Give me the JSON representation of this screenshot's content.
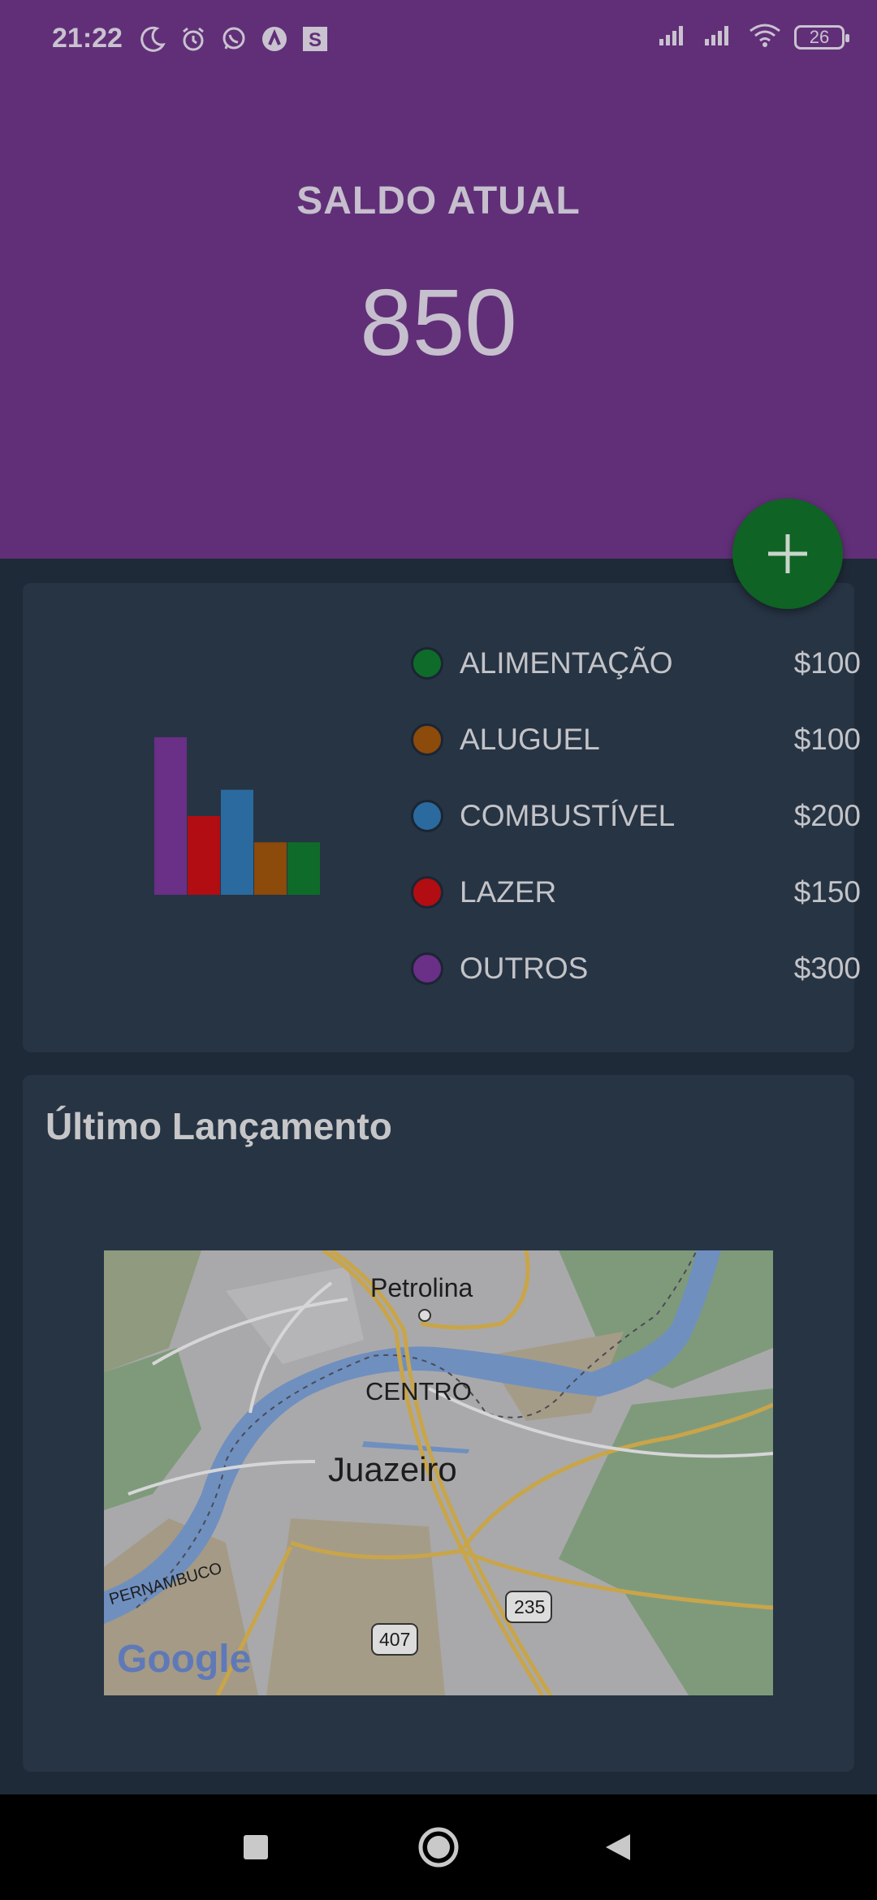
{
  "status_bar": {
    "time": "21:22",
    "battery": "26",
    "icons": [
      "moon-icon",
      "alarm-icon",
      "whatsapp-icon",
      "app-a-icon",
      "app-s-icon",
      "signal-icon",
      "signal-icon",
      "wifi-icon",
      "battery-icon"
    ]
  },
  "header": {
    "saldo_label": "SALDO ATUAL",
    "saldo_value": "850"
  },
  "fab": {
    "icon": "plus-icon"
  },
  "legend": {
    "items": [
      {
        "label": "ALIMENTAÇÃO",
        "amount": "$100",
        "color": "#0f6b2a"
      },
      {
        "label": "ALUGUEL",
        "amount": "$100",
        "color": "#8c4a0b"
      },
      {
        "label": "COMBUSTÍVEL",
        "amount": "$200",
        "color": "#2a6a9e"
      },
      {
        "label": "LAZER",
        "amount": "$150",
        "color": "#b10d12"
      },
      {
        "label": "OUTROS",
        "amount": "$300",
        "color": "#6a2f86"
      }
    ]
  },
  "chart_data": {
    "type": "bar",
    "categories": [
      "OUTROS",
      "LAZER",
      "COMBUSTÍVEL",
      "ALUGUEL",
      "ALIMENTAÇÃO"
    ],
    "values": [
      300,
      150,
      200,
      100,
      100
    ],
    "colors": [
      "#6a2f86",
      "#b10d12",
      "#2a6a9e",
      "#8c4a0b",
      "#0f6b2a"
    ],
    "title": "",
    "xlabel": "",
    "ylabel": "",
    "ylim": [
      0,
      300
    ],
    "grid": false
  },
  "last_entry": {
    "title": "Último Lançamento",
    "map": {
      "labels": {
        "petrolina": "Petrolina",
        "centro": "CENTRO",
        "juazeiro": "Juazeiro",
        "pernambuco": "PERNAMBUCO",
        "road_407": "407",
        "road_235": "235",
        "logo": "Google"
      }
    }
  },
  "nav_bar": {
    "buttons": [
      "recents-square-icon",
      "home-circle-icon",
      "back-triangle-icon"
    ]
  }
}
